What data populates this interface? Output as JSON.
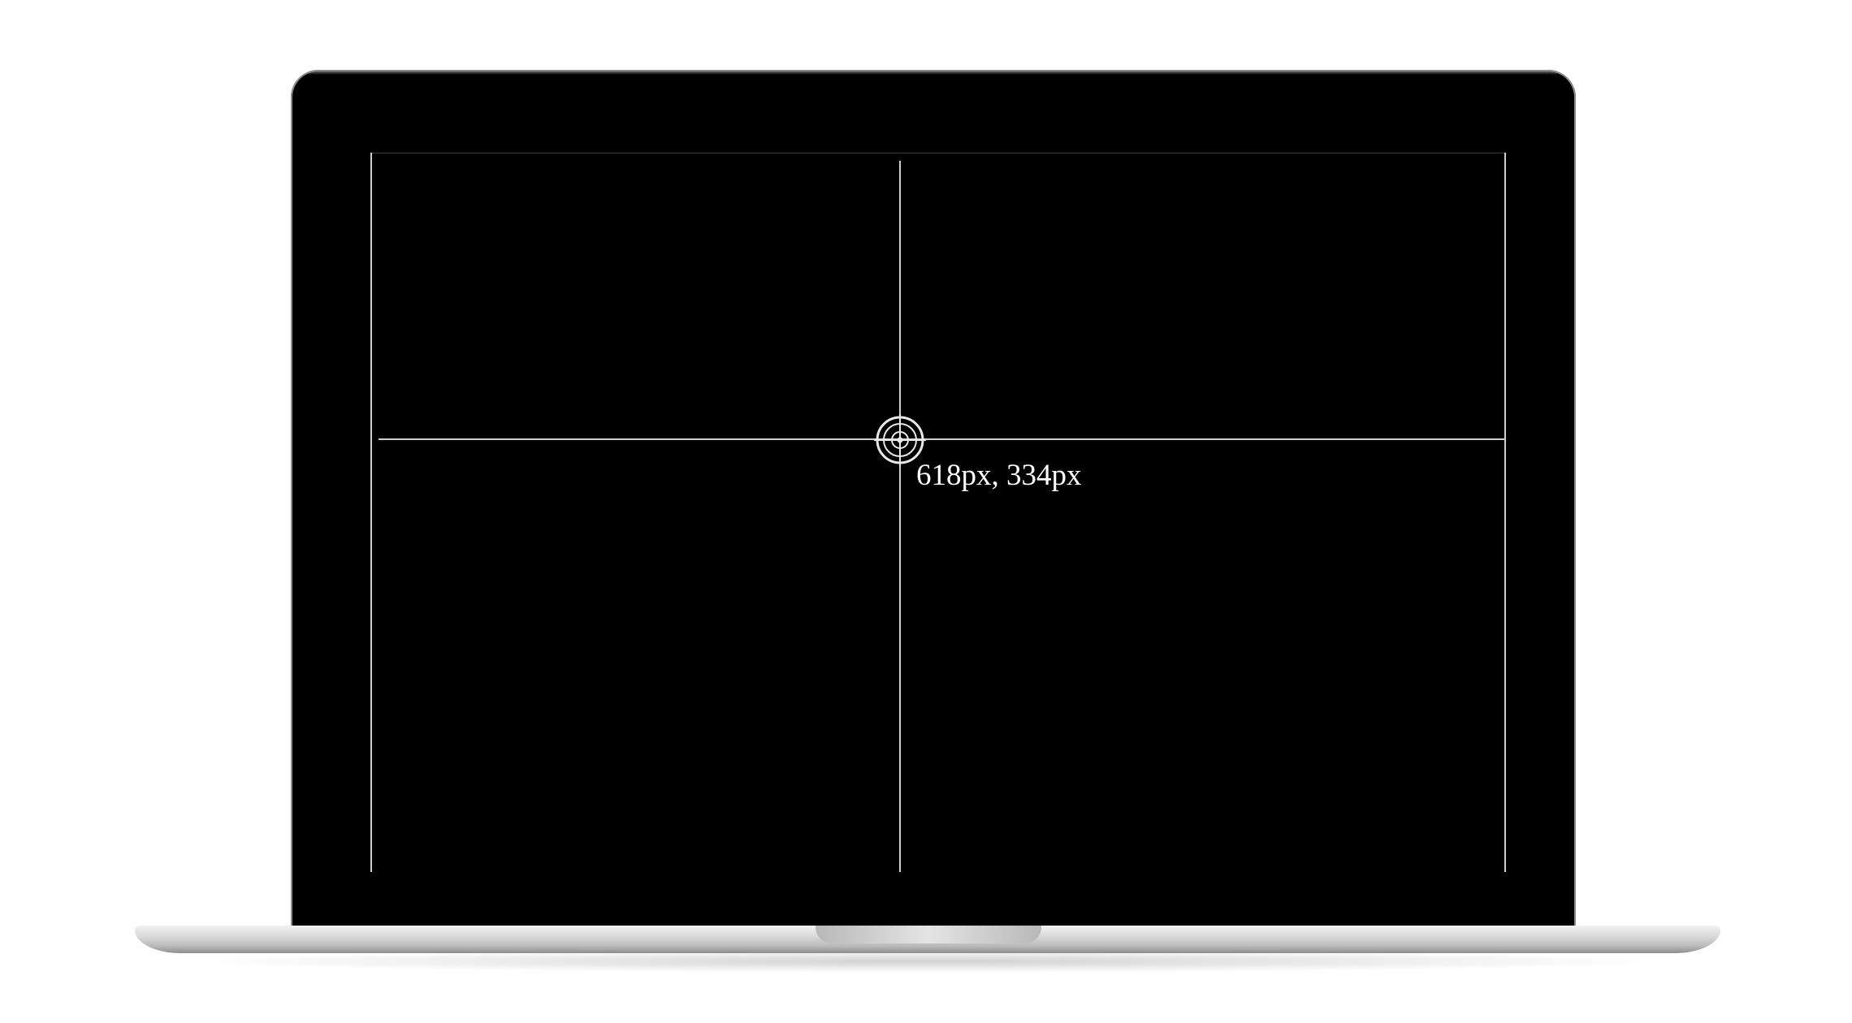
{
  "device": {
    "type": "laptop",
    "bezel_color": "#000000",
    "body_color": "#c8c8c8"
  },
  "screen": {
    "background_color": "#000000",
    "line_color": "#cfcfcf",
    "crosshair": {
      "icon": "target-crosshair-icon",
      "coordinate_readout": "618px, 334px"
    }
  }
}
